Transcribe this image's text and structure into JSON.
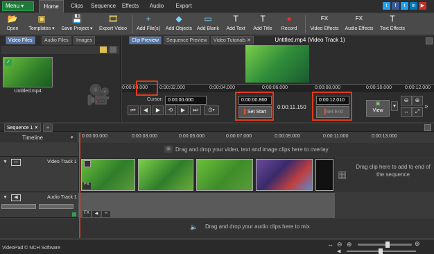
{
  "menubar": {
    "menu_label": "Menu ▾",
    "tabs": [
      "Home",
      "Clips",
      "Sequence",
      "Effects",
      "Audio",
      "Export"
    ],
    "social": [
      "t",
      "f",
      "t",
      "in",
      "▶"
    ]
  },
  "ribbon": {
    "buttons": [
      {
        "label": "Open",
        "icon": "open-folder-icon",
        "glyph": "📂"
      },
      {
        "label": "Templates ▾",
        "icon": "templates-icon",
        "glyph": "▣"
      },
      {
        "label": "Save Project ▾",
        "icon": "save-icon",
        "glyph": "💾"
      },
      {
        "label": "Export Video",
        "icon": "export-video-icon",
        "glyph": "🎞"
      },
      {
        "label": "Add File(s)",
        "icon": "add-files-icon",
        "glyph": "+"
      },
      {
        "label": "Add Objects",
        "icon": "add-objects-icon",
        "glyph": "◆"
      },
      {
        "label": "Add Blank",
        "icon": "add-blank-icon",
        "glyph": "▭"
      },
      {
        "label": "Add Text",
        "icon": "add-text-icon",
        "glyph": "T"
      },
      {
        "label": "Add Title",
        "icon": "add-title-icon",
        "glyph": "T"
      },
      {
        "label": "Record",
        "icon": "record-icon",
        "glyph": "●"
      },
      {
        "label": "Video Effects",
        "icon": "video-effects-icon",
        "glyph": "FX"
      },
      {
        "label": "Audio Effects",
        "icon": "audio-effects-icon",
        "glyph": "FX"
      },
      {
        "label": "Text Effects",
        "icon": "text-effects-icon",
        "glyph": "T"
      }
    ]
  },
  "left_panel": {
    "tabs": [
      "Video Files",
      "Audio Files",
      "Images"
    ],
    "clip_name": "Untitled.mp4"
  },
  "preview": {
    "tabs": [
      "Clip Preview",
      "Sequence Preview",
      "Video Tutorials"
    ],
    "title": "Untitled.mp4 (Video Track 1)",
    "ruler": [
      "0:00:00.000",
      "0:00:02.000",
      "0:00:04.000",
      "0:00:06.000",
      "0:00:08.000",
      "0:00:10.000",
      "0:00:12.000"
    ],
    "cursor_label": "Cursor:",
    "cursor_value": "0:00:00.000",
    "start_value": "0:00:00.860",
    "set_start": "Set Start",
    "duration": "0:00:11.150",
    "end_value": "0:00:12.010",
    "set_end": "Set End",
    "view_label": "View"
  },
  "sequence": {
    "tab": "Sequence 1",
    "timeline_label": "Timeline",
    "ticks": [
      "0:00:00.000",
      "0:00:03.000",
      "0:00:05.000",
      "0:00:07.000",
      "0:00:09.000",
      "0:00:11.000",
      "0:00:13.000"
    ],
    "overlay_msg": "Drag and drop your video, text and image clips here to overlay",
    "video_track": "Video Track 1",
    "drag_end_msg": "Drag clip here to add to end of the sequence",
    "audio_track": "Audio Track 1",
    "audio_msg": "Drag and drop your audio clips here to mix"
  },
  "status": {
    "text": "VideoPad © NCH Software"
  }
}
